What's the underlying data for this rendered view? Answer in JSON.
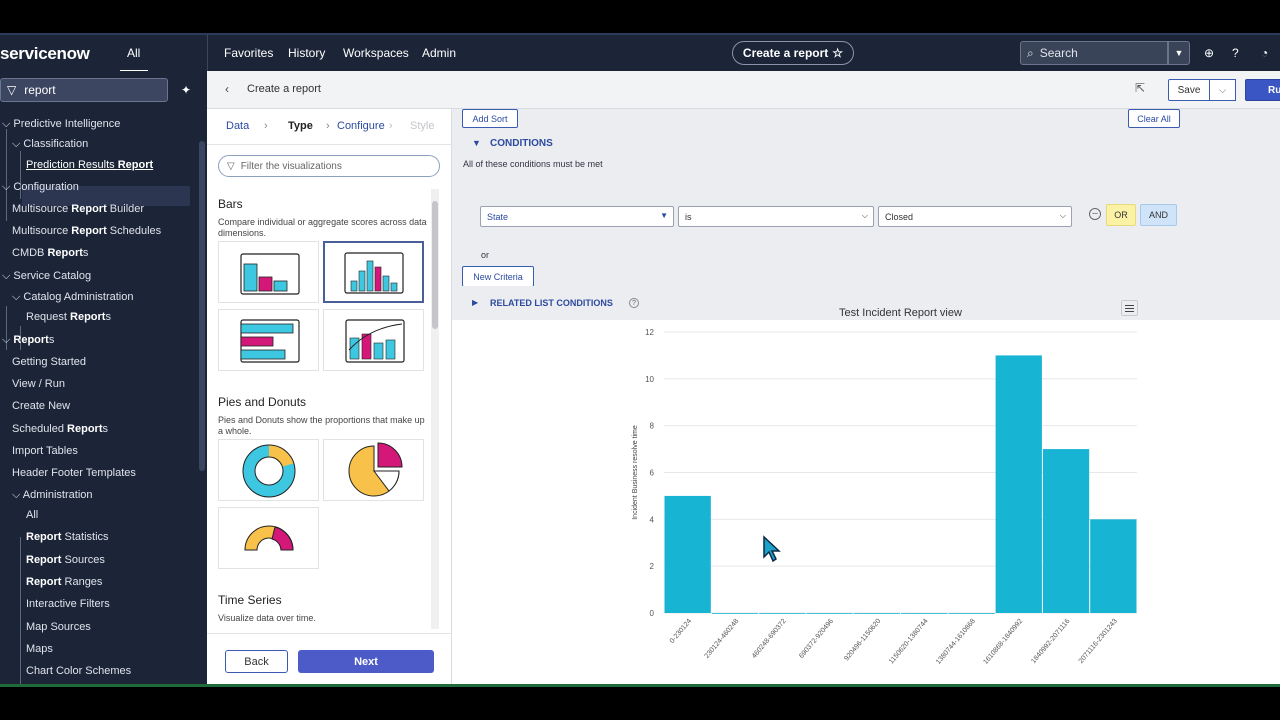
{
  "topnav": {
    "logo": "servicenow",
    "all": "All",
    "links": [
      "Favorites",
      "History",
      "Workspaces",
      "Admin"
    ],
    "create_report": "Create a report",
    "search_placeholder": "Search"
  },
  "leftnav": {
    "filter_value": "report",
    "items": [
      {
        "pre": "Predictive Intelligence",
        "bold": "",
        "post": ""
      },
      {
        "pre": "Classification",
        "bold": "",
        "post": ""
      },
      {
        "pre": "Prediction Results ",
        "bold": "Report",
        "post": ""
      },
      {
        "pre": "Configuration",
        "bold": "",
        "post": ""
      },
      {
        "pre": "Multisource ",
        "bold": "Report",
        "post": " Builder"
      },
      {
        "pre": "Multisource ",
        "bold": "Report",
        "post": " Schedules"
      },
      {
        "pre": "CMDB ",
        "bold": "Report",
        "post": "s"
      },
      {
        "pre": "Service Catalog",
        "bold": "",
        "post": ""
      },
      {
        "pre": "Catalog Administration",
        "bold": "",
        "post": ""
      },
      {
        "pre": "Request ",
        "bold": "Report",
        "post": "s"
      },
      {
        "pre": "",
        "bold": "Report",
        "post": "s"
      },
      {
        "pre": "Getting Started",
        "bold": "",
        "post": ""
      },
      {
        "pre": "View / Run",
        "bold": "",
        "post": ""
      },
      {
        "pre": "Create New",
        "bold": "",
        "post": ""
      },
      {
        "pre": "Scheduled ",
        "bold": "Report",
        "post": "s"
      },
      {
        "pre": "Import Tables",
        "bold": "",
        "post": ""
      },
      {
        "pre": "Header Footer Templates",
        "bold": "",
        "post": ""
      },
      {
        "pre": "Administration",
        "bold": "",
        "post": ""
      },
      {
        "pre": "All",
        "bold": "",
        "post": ""
      },
      {
        "pre": "",
        "bold": "Report",
        "post": " Statistics"
      },
      {
        "pre": "",
        "bold": "Report",
        "post": " Sources"
      },
      {
        "pre": "",
        "bold": "Report",
        "post": " Ranges"
      },
      {
        "pre": "Interactive Filters",
        "bold": "",
        "post": ""
      },
      {
        "pre": "Map Sources",
        "bold": "",
        "post": ""
      },
      {
        "pre": "Maps",
        "bold": "",
        "post": ""
      },
      {
        "pre": "Chart Color Schemes",
        "bold": "",
        "post": ""
      }
    ]
  },
  "subheader": {
    "title": "Create a report",
    "save": "Save",
    "run": "Ru"
  },
  "steps": [
    "Data",
    "Type",
    "Configure",
    "Style"
  ],
  "viz": {
    "filter_placeholder": "Filter the visualizations",
    "sections": [
      {
        "title": "Bars",
        "desc": "Compare individual or aggregate scores across data dimensions."
      },
      {
        "title": "Pies and Donuts",
        "desc": "Pies and Donuts show the proportions that make up a whole."
      },
      {
        "title": "Time Series",
        "desc": "Visualize data over time."
      }
    ],
    "back": "Back",
    "next": "Next"
  },
  "config": {
    "add_sort": "Add Sort",
    "clear_all": "Clear All",
    "conditions": "CONDITIONS",
    "must_be_met": "All of these conditions must be met",
    "field": "State",
    "operator": "is",
    "value": "Closed",
    "or_btn": "OR",
    "and_btn": "AND",
    "or_text": "or",
    "new_criteria": "New Criteria",
    "related": "RELATED LIST CONDITIONS"
  },
  "colors": {
    "bar": "#17b4d4",
    "magenta": "#d4187a",
    "yellow": "#f8c24a",
    "cyan": "#3ec7e0",
    "nav_bg": "#1c2537"
  },
  "chart_data": {
    "type": "bar",
    "title": "Test Incident Report view",
    "ylabel": "Incident Business resolve time",
    "xlabel": "",
    "categories": [
      "0-230124",
      "230124-460248",
      "460248-690372",
      "690372-920496",
      "920496-1150620",
      "1150620-1380744",
      "1380744-1610868",
      "1610868-1840992",
      "1840992-2071116",
      "2071116-2301243"
    ],
    "values": [
      5,
      0,
      0,
      0,
      0,
      0,
      0,
      11,
      7,
      4
    ],
    "ylim": [
      0,
      12
    ],
    "yticks": [
      0,
      2,
      4,
      6,
      8,
      10,
      12
    ],
    "grid": true
  }
}
